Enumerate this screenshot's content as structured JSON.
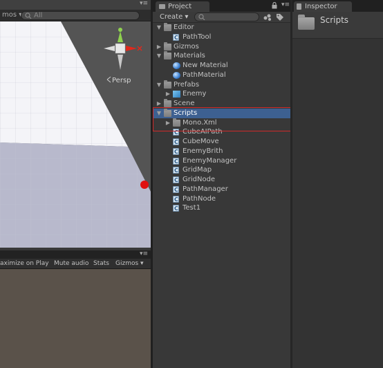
{
  "scene": {
    "gizmos_label": "mos ▾",
    "search_placeholder": "All",
    "tab_menu": "▾≡",
    "persp_label": "Persp"
  },
  "game": {
    "tab_menu": "▾≡",
    "toolbar": {
      "maximize": "aximize on Play",
      "mute": "Mute audio",
      "stats": "Stats",
      "gizmos": "Gizmos ▾"
    }
  },
  "project": {
    "tab_label": "Project",
    "menu": "▾≡",
    "create_label": "Create ▾",
    "tree": [
      {
        "label": "Editor",
        "kind": "folder",
        "depth": 0,
        "expanded": true
      },
      {
        "label": "PathTool",
        "kind": "script",
        "depth": 1
      },
      {
        "label": "Gizmos",
        "kind": "folder",
        "depth": 0,
        "expanded": false
      },
      {
        "label": "Materials",
        "kind": "folder",
        "depth": 0,
        "expanded": true
      },
      {
        "label": "New Material",
        "kind": "material",
        "depth": 1
      },
      {
        "label": "PathMaterial",
        "kind": "material",
        "depth": 1
      },
      {
        "label": "Prefabs",
        "kind": "folder",
        "depth": 0,
        "expanded": true
      },
      {
        "label": "Enemy",
        "kind": "prefab",
        "depth": 1
      },
      {
        "label": "Scene",
        "kind": "folder",
        "depth": 0,
        "expanded": false
      },
      {
        "label": "Scripts",
        "kind": "folder",
        "depth": 0,
        "expanded": true,
        "selected": true
      },
      {
        "label": "Mono.Xml",
        "kind": "folder",
        "depth": 1,
        "expanded": false
      },
      {
        "label": "CubeAIPath",
        "kind": "script",
        "depth": 1
      },
      {
        "label": "CubeMove",
        "kind": "script",
        "depth": 1
      },
      {
        "label": "EnemyBrith",
        "kind": "script",
        "depth": 1
      },
      {
        "label": "EnemyManager",
        "kind": "script",
        "depth": 1
      },
      {
        "label": "GridMap",
        "kind": "script",
        "depth": 1
      },
      {
        "label": "GridNode",
        "kind": "script",
        "depth": 1
      },
      {
        "label": "PathManager",
        "kind": "script",
        "depth": 1
      },
      {
        "label": "PathNode",
        "kind": "script",
        "depth": 1
      },
      {
        "label": "Test1",
        "kind": "script",
        "depth": 1
      }
    ]
  },
  "inspector": {
    "tab_label": "Inspector",
    "title": "Scripts"
  },
  "colors": {
    "selection": "#3d6091",
    "highlight_box": "#d02a2a"
  }
}
